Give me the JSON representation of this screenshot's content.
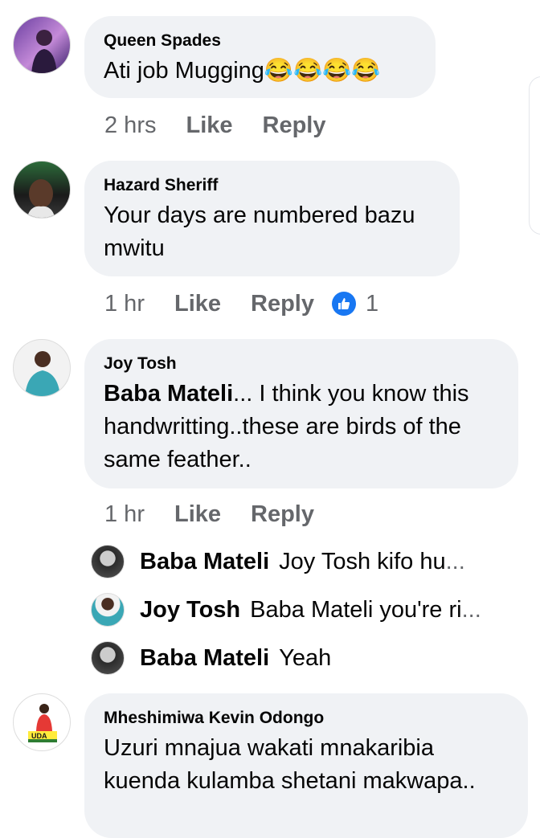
{
  "comments": [
    {
      "author": "Queen Spades",
      "text": "Ati job Mugging",
      "emojis": [
        "😂",
        "😂",
        "😂",
        "😂"
      ],
      "time": "2 hrs",
      "like_label": "Like",
      "reply_label": "Reply"
    },
    {
      "author": "Hazard Sheriff",
      "text_line1": "Your days are numbered bazu",
      "text_line2": "mwitu",
      "time": "1 hr",
      "like_label": "Like",
      "reply_label": "Reply",
      "reaction_count": "1",
      "reaction_icon": "thumbs-up-icon"
    },
    {
      "author": "Joy Tosh",
      "mention": "Baba Mateli",
      "text_line1": "... I think you know this",
      "text_line2": "handwritting..these are birds of the",
      "text_line3": "same feather..",
      "time": "1 hr",
      "like_label": "Like",
      "reply_label": "Reply",
      "replies": [
        {
          "author": "Baba Mateli",
          "text": "Joy Tosh kifo hu",
          "truncated": "..."
        },
        {
          "author": "Joy Tosh",
          "text": "Baba Mateli you're ri",
          "truncated": "..."
        },
        {
          "author": "Baba Mateli",
          "text": "Yeah"
        }
      ]
    },
    {
      "author": "Mheshimiwa Kevin Odongo",
      "text_line1": "Uzuri mnajua wakati mnakaribia",
      "text_line2": "kuenda kulamba shetani makwapa..",
      "avatar_badge": "UDA"
    }
  ],
  "colors": {
    "bubble": "#f0f2f5",
    "secondary_text": "#65676b",
    "like_blue": "#1877f2"
  }
}
